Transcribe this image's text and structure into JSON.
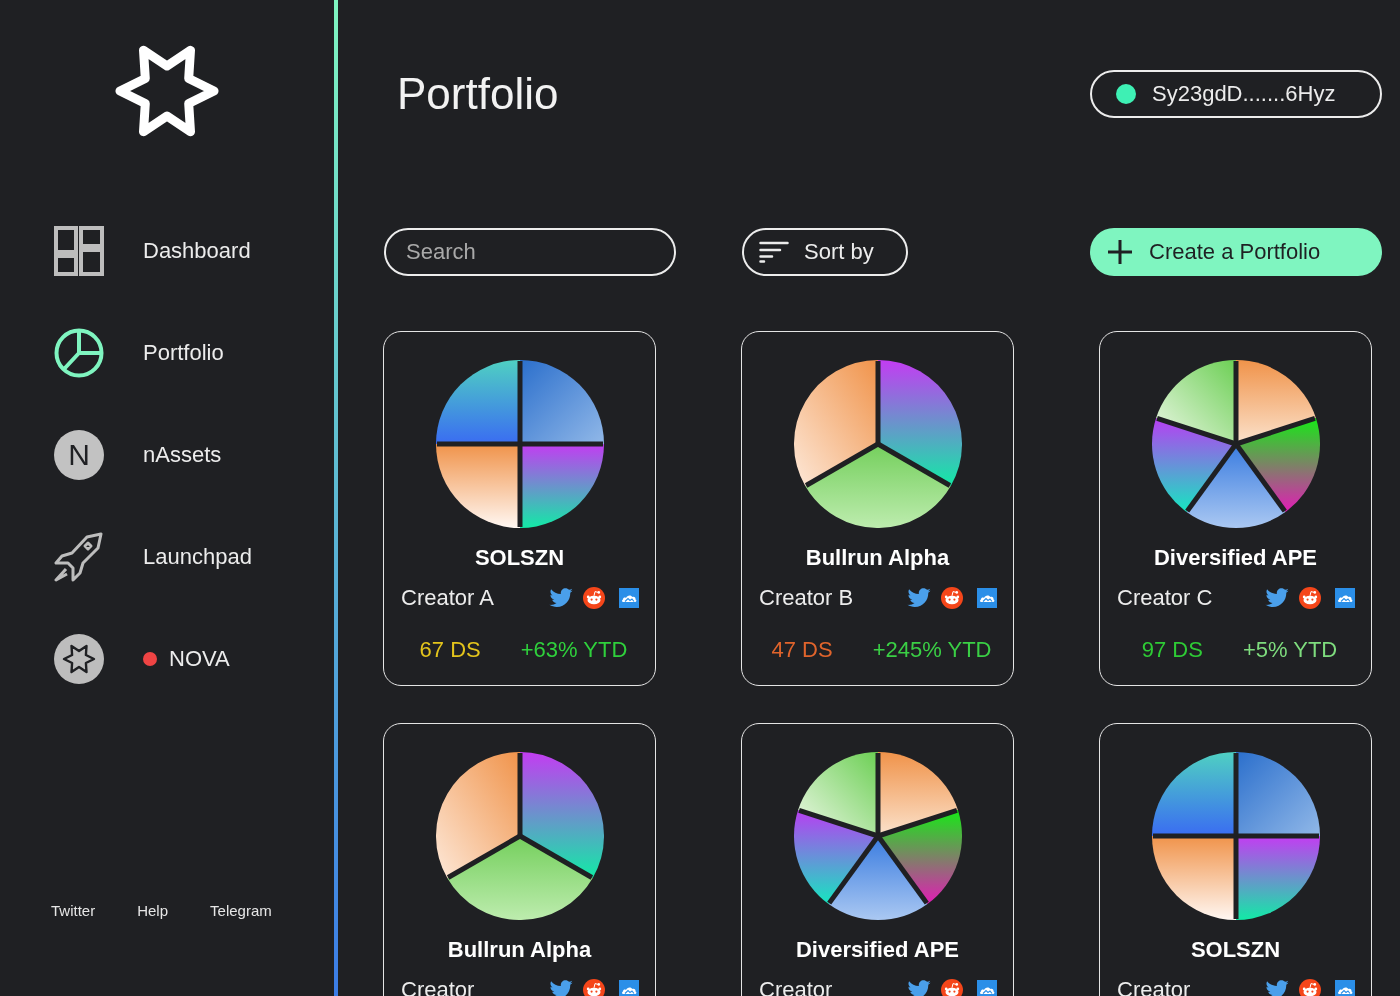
{
  "sidebar": {
    "items": [
      {
        "label": "Dashboard",
        "selected": false
      },
      {
        "label": "Portfolio",
        "selected": true
      },
      {
        "label": "nAssets",
        "selected": false,
        "icon_letter": "N"
      },
      {
        "label": "Launchpad",
        "selected": false
      },
      {
        "label": "NOVA",
        "selected": false,
        "color": "#ef4444"
      }
    ],
    "footer_links": [
      "Twitter",
      "Help",
      "Telegram"
    ]
  },
  "header": {
    "title": "Portfolio",
    "wallet": {
      "address": "Sy23gdD.......6Hyz",
      "connected": true
    }
  },
  "toolbar": {
    "search": {
      "placeholder": "Search"
    },
    "sort_button": "Sort by",
    "create_button": "Create a Portfolio"
  },
  "portfolios": [
    {
      "kind": "quarters",
      "name": "SOLSZN",
      "creator": "Creator A",
      "score": {
        "text": "67 DS",
        "color": "#e3c41c"
      },
      "ytd": {
        "text": "+63% YTD",
        "color": "#2fd03c"
      }
    },
    {
      "kind": "thirds",
      "name": "Bullrun Alpha",
      "creator": "Creator B",
      "score": {
        "text": "47 DS",
        "color": "#e0642c"
      },
      "ytd": {
        "text": "+245% YTD",
        "color": "#3acf45"
      }
    },
    {
      "kind": "fifths",
      "name": "Diversified APE",
      "creator": "Creator C",
      "score": {
        "text": "97 DS",
        "color": "#2ecb35"
      },
      "ytd": {
        "text": "+5% YTD",
        "color": "#7edc7e"
      }
    },
    {
      "kind": "thirds",
      "name": "Bullrun Alpha",
      "creator": "Creator"
    },
    {
      "kind": "fifths",
      "name": "Diversified APE",
      "creator": "Creator"
    },
    {
      "kind": "quarters",
      "name": "SOLSZN",
      "creator": "Creator"
    }
  ]
}
